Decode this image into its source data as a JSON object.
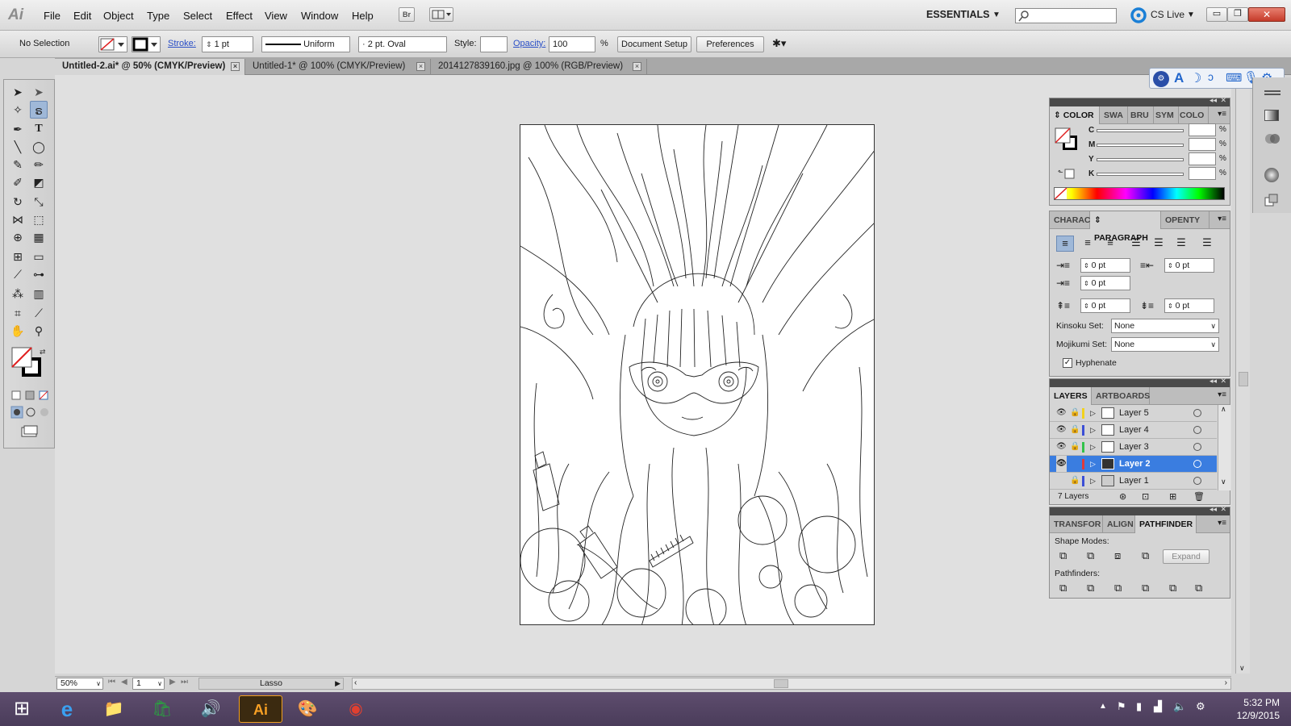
{
  "app": {
    "logo": "Ai",
    "menus": [
      "File",
      "Edit",
      "Object",
      "Type",
      "Select",
      "Effect",
      "View",
      "Window",
      "Help"
    ],
    "bridge_label": "Br",
    "workspace": "ESSENTIALS",
    "cs_live": "CS Live"
  },
  "control_bar": {
    "selection": "No Selection",
    "stroke_label": "Stroke:",
    "stroke_value": "1 pt",
    "profile": "Uniform",
    "brush": "2 pt. Oval",
    "style_label": "Style:",
    "opacity_label": "Opacity:",
    "opacity_value": "100",
    "opacity_unit": "%",
    "document_setup": "Document Setup",
    "preferences": "Preferences"
  },
  "tabs": [
    {
      "label": "Untitled-2.ai* @ 50% (CMYK/Preview)",
      "active": true
    },
    {
      "label": "Untitled-1* @ 100% (CMYK/Preview)",
      "active": false
    },
    {
      "label": "2014127839160.jpg @ 100% (RGB/Preview)",
      "active": false
    }
  ],
  "status": {
    "zoom": "50%",
    "page": "1",
    "tool": "Lasso"
  },
  "color_panel": {
    "tabs": [
      "COLOR",
      "SWA",
      "BRU",
      "SYM",
      "COLO"
    ],
    "channels": [
      "C",
      "M",
      "Y",
      "K"
    ],
    "unit": "%"
  },
  "paragraph_panel": {
    "tabs": [
      "CHARAC",
      "PARAGRAPH",
      "OPENTY"
    ],
    "left_indent": "0 pt",
    "right_indent": "0 pt",
    "first_indent": "0 pt",
    "space_before": "0 pt",
    "space_after": "0 pt",
    "kinsoku_label": "Kinsoku Set:",
    "kinsoku_value": "None",
    "mojikumi_label": "Mojikumi Set:",
    "mojikumi_value": "None",
    "hyphenate": "Hyphenate"
  },
  "layers_panel": {
    "tabs": [
      "LAYERS",
      "ARTBOARDS"
    ],
    "layers": [
      {
        "name": "Layer 5",
        "color": "#f2d21c",
        "selected": false
      },
      {
        "name": "Layer 4",
        "color": "#3c4fd6",
        "selected": false
      },
      {
        "name": "Layer 3",
        "color": "#32c24a",
        "selected": false
      },
      {
        "name": "Layer 2",
        "color": "#e03a3a",
        "selected": true
      },
      {
        "name": "Layer 1",
        "color": "#3c4fd6",
        "selected": false
      }
    ],
    "count": "7 Layers"
  },
  "pathfinder_panel": {
    "tabs": [
      "TRANSFOR",
      "ALIGN",
      "PATHFINDER"
    ],
    "shape_modes": "Shape Modes:",
    "expand": "Expand",
    "pathfinders": "Pathfinders:"
  },
  "clock": {
    "time": "5:32 PM",
    "date": "12/9/2015"
  },
  "colors": {
    "selection": "#3a7de0",
    "taskbar": "#5a4a6a"
  }
}
